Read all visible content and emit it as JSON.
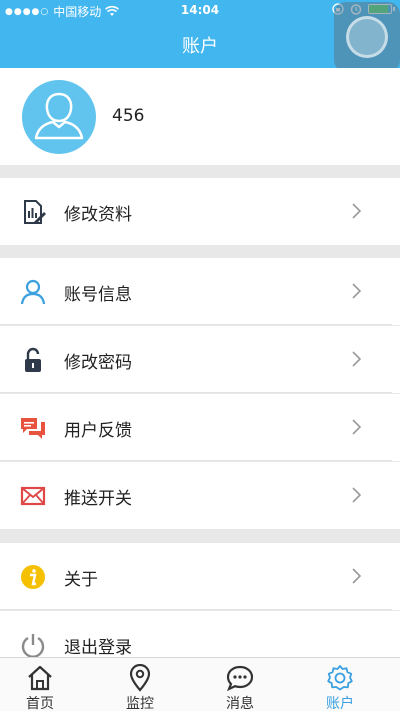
{
  "status_bar": {
    "signal": "●●●●○",
    "carrier": "中国移动",
    "time": "14:04"
  },
  "header": {
    "title": "账户"
  },
  "profile": {
    "username": "456"
  },
  "menu": {
    "edit_profile": "修改资料",
    "account_info": "账号信息",
    "change_password": "修改密码",
    "feedback": "用户反馈",
    "push_switch": "推送开关",
    "about": "关于",
    "logout": "退出登录"
  },
  "tabs": [
    {
      "label": "首页",
      "icon": "home-icon"
    },
    {
      "label": "监控",
      "icon": "location-pin-icon"
    },
    {
      "label": "消息",
      "icon": "chat-bubble-icon"
    },
    {
      "label": "账户",
      "icon": "gear-icon",
      "active": true
    }
  ],
  "colors": {
    "header": "#42b6ee",
    "avatar": "#61c4ee",
    "active_tab": "#3aa0e0",
    "feedback_icon": "#e8533f",
    "mail_icon": "#e04848",
    "about_icon": "#f5c000"
  }
}
